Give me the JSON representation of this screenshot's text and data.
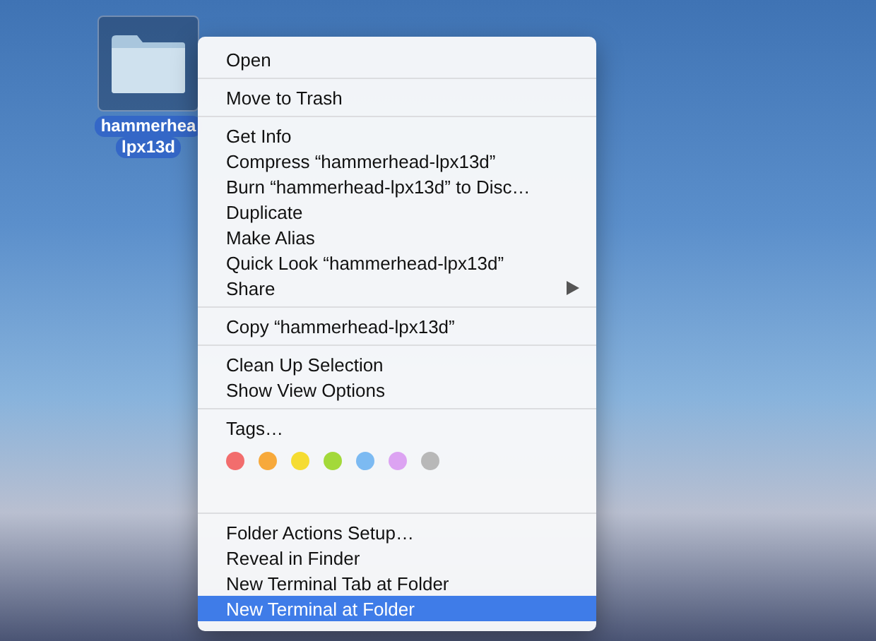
{
  "desktop_icon": {
    "label_lines": [
      "hammerhea",
      "lpx13d"
    ],
    "selected": true
  },
  "context_menu": {
    "sections": [
      {
        "items": [
          {
            "label": "Open",
            "selected": false
          }
        ]
      },
      {
        "items": [
          {
            "label": "Move to Trash",
            "selected": false
          }
        ]
      },
      {
        "items": [
          {
            "label": "Get Info",
            "selected": false
          },
          {
            "label": "Compress “hammerhead-lpx13d”",
            "selected": false
          },
          {
            "label": "Burn “hammerhead-lpx13d” to Disc…",
            "selected": false
          },
          {
            "label": "Duplicate",
            "selected": false
          },
          {
            "label": "Make Alias",
            "selected": false
          },
          {
            "label": "Quick Look “hammerhead-lpx13d”",
            "selected": false
          },
          {
            "label": "Share",
            "selected": false,
            "submenu": true
          }
        ]
      },
      {
        "items": [
          {
            "label": "Copy “hammerhead-lpx13d”",
            "selected": false
          }
        ]
      },
      {
        "items": [
          {
            "label": "Clean Up Selection",
            "selected": false
          },
          {
            "label": "Show View Options",
            "selected": false
          }
        ]
      },
      {
        "items": [
          {
            "label": "Tags…",
            "selected": false
          }
        ],
        "tags": [
          {
            "color": "#f26d6d"
          },
          {
            "color": "#f7a93b"
          },
          {
            "color": "#f5dc32"
          },
          {
            "color": "#a3d93a"
          },
          {
            "color": "#7cbaf2"
          },
          {
            "color": "#dca3f2"
          },
          {
            "color": "#b8b8b8"
          }
        ]
      },
      {
        "items": [
          {
            "label": "Folder Actions Setup…",
            "selected": false
          },
          {
            "label": "Reveal in Finder",
            "selected": false
          },
          {
            "label": "New Terminal Tab at Folder",
            "selected": false
          },
          {
            "label": "New Terminal at Folder",
            "selected": true
          }
        ]
      }
    ]
  }
}
